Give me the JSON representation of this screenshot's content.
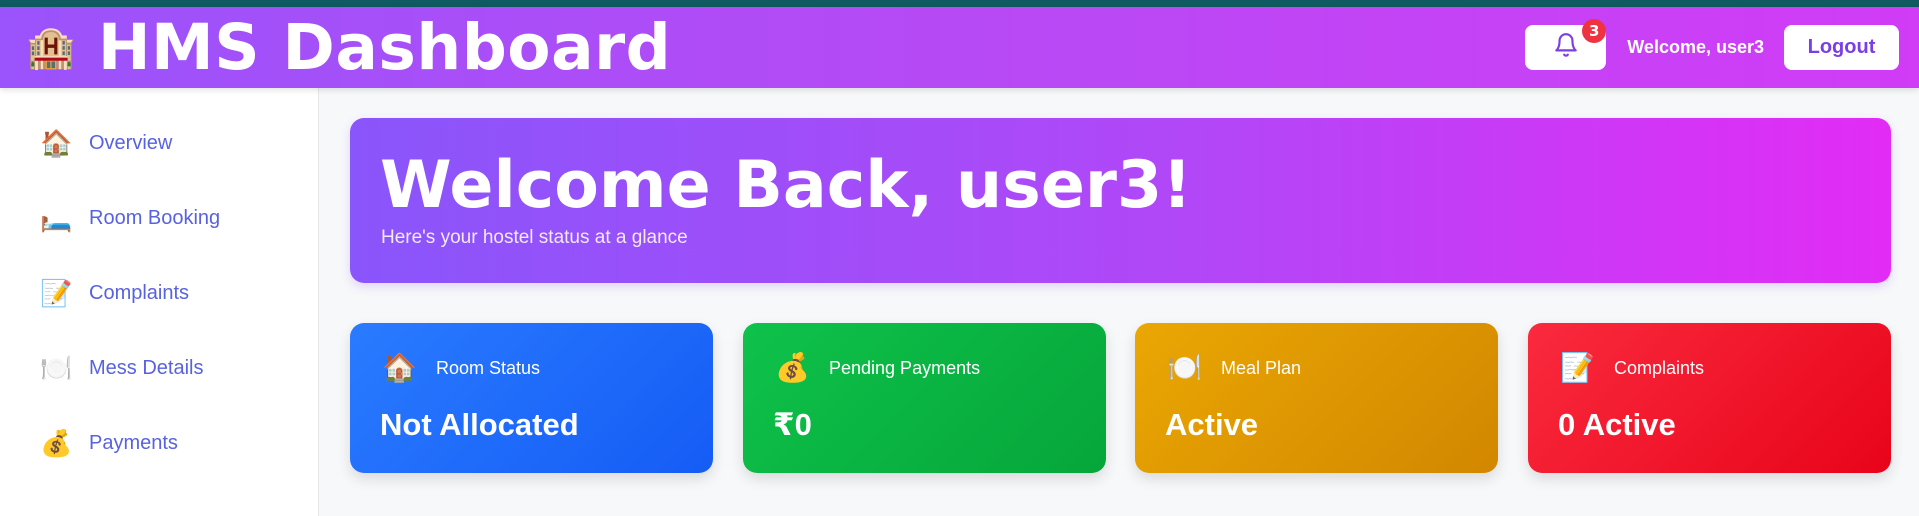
{
  "header": {
    "brand_icon": "🏨",
    "title": "HMS Dashboard",
    "notification_count": "3",
    "welcome": "Welcome, user3",
    "logout_label": "Logout"
  },
  "sidebar": {
    "items": [
      {
        "icon": "🏠",
        "label": "Overview"
      },
      {
        "icon": "🛏️",
        "label": "Room Booking"
      },
      {
        "icon": "📝",
        "label": "Complaints"
      },
      {
        "icon": "🍽️",
        "label": "Mess Details"
      },
      {
        "icon": "💰",
        "label": "Payments"
      }
    ]
  },
  "banner": {
    "title": "Welcome Back, user3!",
    "subtitle": "Here's your hostel status at a glance"
  },
  "cards": [
    {
      "icon": "🏠",
      "label": "Room Status",
      "value": "Not Allocated"
    },
    {
      "icon": "💰",
      "label": "Pending Payments",
      "value": "₹0"
    },
    {
      "icon": "🍽️",
      "label": "Meal Plan",
      "value": "Active"
    },
    {
      "icon": "📝",
      "label": "Complaints",
      "value": "0 Active"
    }
  ],
  "colors": {
    "header_gradient": [
      "#9b53fb",
      "#d13cf6"
    ],
    "nav_text": "#5862e0",
    "card_room": "#1f6bff",
    "card_payments": "#09b543",
    "card_meal": "#e09a02",
    "card_complaints": "#f1152b",
    "badge": "#ef3340"
  }
}
